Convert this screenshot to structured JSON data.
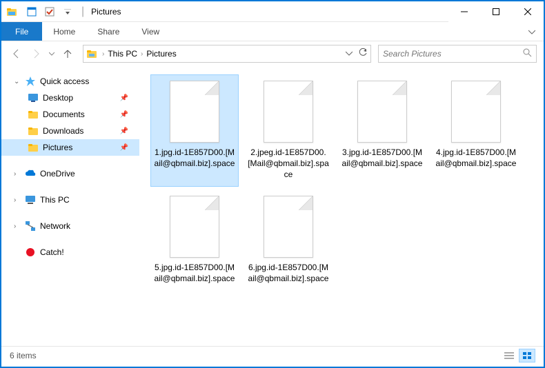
{
  "window": {
    "title": "Pictures"
  },
  "ribbon": {
    "file": "File",
    "tabs": [
      "Home",
      "Share",
      "View"
    ]
  },
  "breadcrumb": {
    "items": [
      "This PC",
      "Pictures"
    ]
  },
  "search": {
    "placeholder": "Search Pictures"
  },
  "sidebar": {
    "quick_access": "Quick access",
    "quick_items": [
      {
        "label": "Desktop"
      },
      {
        "label": "Documents"
      },
      {
        "label": "Downloads"
      },
      {
        "label": "Pictures",
        "selected": true
      }
    ],
    "onedrive": "OneDrive",
    "this_pc": "This PC",
    "network": "Network",
    "catch": "Catch!"
  },
  "files": [
    {
      "name": "1.jpg.id-1E857D00.[Mail@qbmail.biz].space",
      "selected": true
    },
    {
      "name": "2.jpeg.id-1E857D00.[Mail@qbmail.biz].space"
    },
    {
      "name": "3.jpg.id-1E857D00.[Mail@qbmail.biz].space"
    },
    {
      "name": "4.jpg.id-1E857D00.[Mail@qbmail.biz].space"
    },
    {
      "name": "5.jpg.id-1E857D00.[Mail@qbmail.biz].space"
    },
    {
      "name": "6.jpg.id-1E857D00.[Mail@qbmail.biz].space"
    }
  ],
  "status": {
    "count": "6 items"
  }
}
